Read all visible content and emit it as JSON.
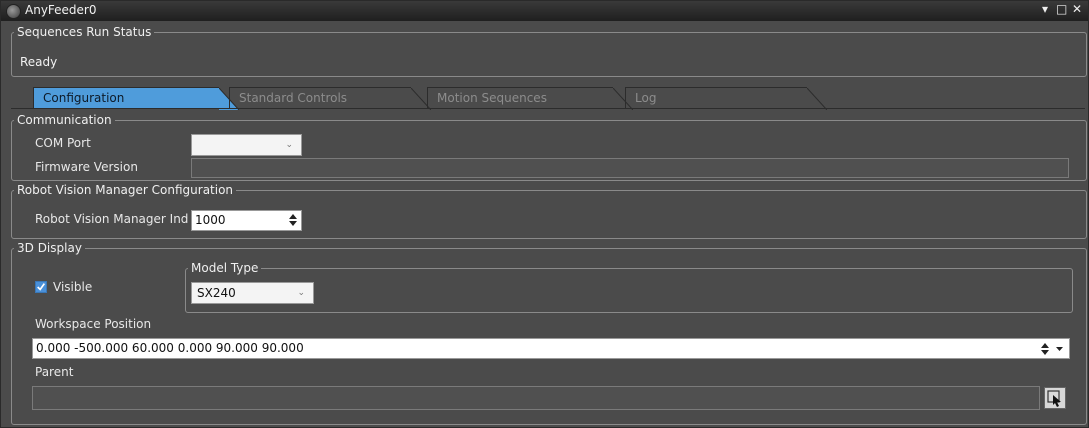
{
  "window": {
    "title": "AnyFeeder0"
  },
  "title_buttons": {
    "pin": "▾",
    "maximize": "□",
    "close": "✕"
  },
  "status": {
    "legend": "Sequences Run Status",
    "value": "Ready"
  },
  "tabs": [
    {
      "label": "Configuration",
      "active": true
    },
    {
      "label": "Standard Controls",
      "active": false
    },
    {
      "label": "Motion Sequences",
      "active": false
    },
    {
      "label": "Log",
      "active": false
    }
  ],
  "communication": {
    "legend": "Communication",
    "com_port_label": "COM Port",
    "com_port_value": "",
    "firmware_label": "Firmware Version",
    "firmware_value": ""
  },
  "rvm": {
    "legend": "Robot Vision Manager Configuration",
    "index_label": "Robot Vision Manager Ind",
    "index_value": "1000"
  },
  "display3d": {
    "legend": "3D Display",
    "visible_label": "Visible",
    "visible_checked": true,
    "model_type_legend": "Model Type",
    "model_type_value": "SX240",
    "workspace_label": "Workspace Position",
    "workspace_value": "0.000 -500.000 60.000 0.000 90.000 90.000",
    "parent_label": "Parent",
    "parent_value": ""
  },
  "icons": {
    "app": "app-icon",
    "chevron": "chevron-down-icon",
    "spinner": "spinner-arrows-icon",
    "check": "checkmark-icon",
    "browse": "cursor-select-icon"
  },
  "colors": {
    "background": "#4b4b4b",
    "active_tab": "#4f9cdb",
    "checkbox": "#4a90d9"
  }
}
